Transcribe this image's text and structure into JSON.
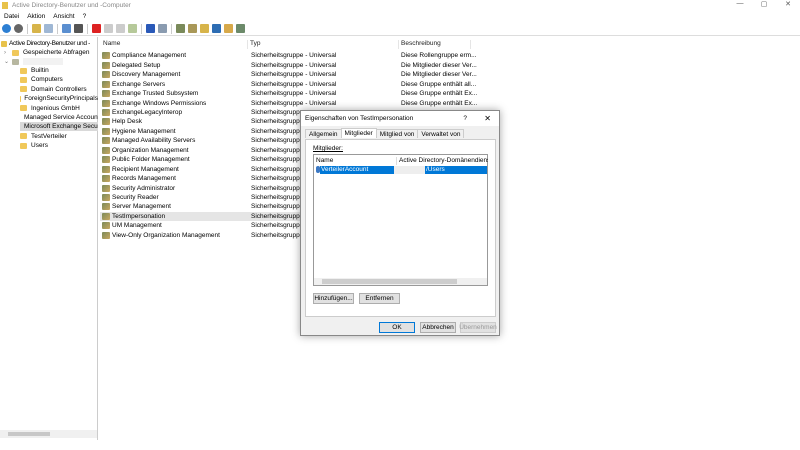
{
  "window": {
    "title": "Active Directory-Benutzer und -Computer",
    "min": "—",
    "max": "▢",
    "close": "✕"
  },
  "menu": [
    "Datei",
    "Aktion",
    "Ansicht",
    "?"
  ],
  "tree": {
    "root": "Active Directory-Benutzer und -",
    "saved": "Gespeicherte Abfragen",
    "items": [
      "Builtin",
      "Computers",
      "Domain Controllers",
      "ForeignSecurityPrincipals",
      "Ingenious GmbH",
      "Managed Service Accounts",
      "Microsoft Exchange Security Groups",
      "TestVerteiler",
      "Users"
    ]
  },
  "list": {
    "headers": [
      "Name",
      "Typ",
      "Beschreibung"
    ],
    "rows": [
      [
        "Compliance Management",
        "Sicherheitsgruppe - Universal",
        "Diese Rollengruppe erm..."
      ],
      [
        "Delegated Setup",
        "Sicherheitsgruppe - Universal",
        "Die Mitglieder dieser Ver..."
      ],
      [
        "Discovery Management",
        "Sicherheitsgruppe - Universal",
        "Die Mitglieder dieser Ver..."
      ],
      [
        "Exchange Servers",
        "Sicherheitsgruppe - Universal",
        "Diese Gruppe enthält all..."
      ],
      [
        "Exchange Trusted Subsystem",
        "Sicherheitsgruppe - Universal",
        "Diese Gruppe enthält Ex..."
      ],
      [
        "Exchange Windows Permissions",
        "Sicherheitsgruppe - Universal",
        "Diese Gruppe enthält Ex..."
      ],
      [
        "ExchangeLegacyInterop",
        "Sicherheitsgruppe",
        ""
      ],
      [
        "Help Desk",
        "Sicherheitsgruppe",
        ""
      ],
      [
        "Hygiene Management",
        "Sicherheitsgruppe",
        ""
      ],
      [
        "Managed Availability Servers",
        "Sicherheitsgruppe",
        ""
      ],
      [
        "Organization Management",
        "Sicherheitsgruppe",
        ""
      ],
      [
        "Public Folder Management",
        "Sicherheitsgruppe",
        ""
      ],
      [
        "Recipient Management",
        "Sicherheitsgruppe",
        ""
      ],
      [
        "Records Management",
        "Sicherheitsgruppe",
        ""
      ],
      [
        "Security Administrator",
        "Sicherheitsgruppe",
        ""
      ],
      [
        "Security Reader",
        "Sicherheitsgruppe",
        ""
      ],
      [
        "Server Management",
        "Sicherheitsgruppe",
        ""
      ],
      [
        "TestImpersonation",
        "Sicherheitsgruppe",
        ""
      ],
      [
        "UM Management",
        "Sicherheitsgruppe",
        ""
      ],
      [
        "View-Only Organization Management",
        "Sicherheitsgruppe",
        ""
      ]
    ],
    "selected": "TestImpersonation"
  },
  "dialog": {
    "title": "Eigenschaften von TestImpersonation",
    "help": "?",
    "close": "✕",
    "tabs": [
      "Allgemein",
      "Mitglieder",
      "Mitglied von",
      "Verwaltet von"
    ],
    "active_tab": "Mitglieder",
    "members_label": "Mitglieder:",
    "columns": [
      "Name",
      "Active Directory-Domänendienste-Ordn"
    ],
    "member": {
      "name": "VerteilerAccount",
      "folder": "/Users"
    },
    "add": "Hinzufügen...",
    "remove": "Entfernen",
    "ok": "OK",
    "cancel": "Abbrechen",
    "apply": "Übernehmen"
  }
}
